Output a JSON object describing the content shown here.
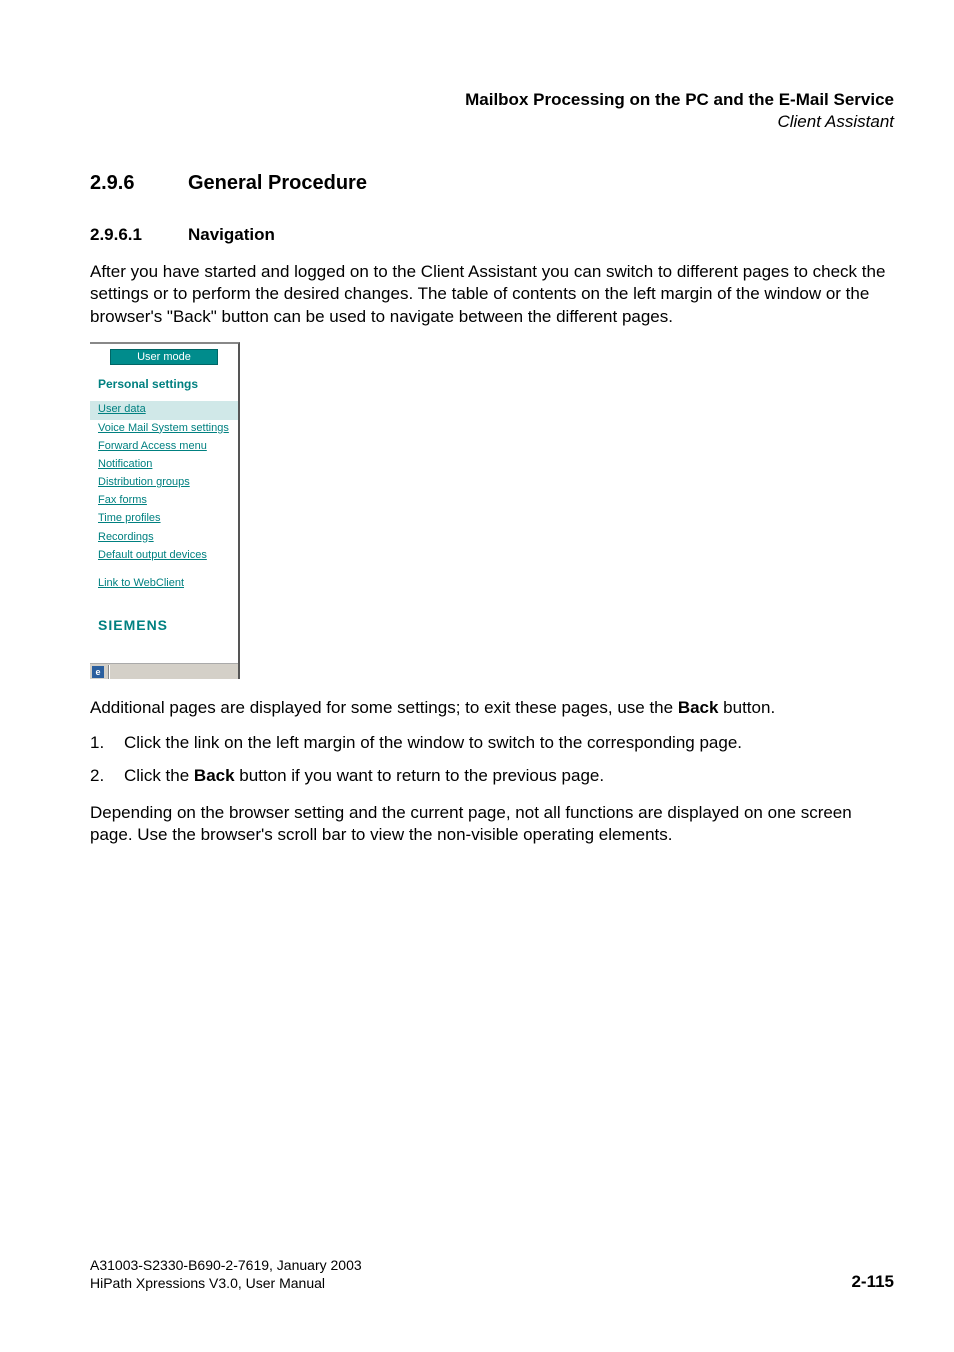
{
  "header": {
    "title": "Mailbox Processing on the PC and the E-Mail Service",
    "subtitle": "Client Assistant"
  },
  "section": {
    "number": "2.9.6",
    "title": "General Procedure"
  },
  "subsection": {
    "number": "2.9.6.1",
    "title": "Navigation"
  },
  "paragraphs": {
    "intro": "After you have started and logged on to the Client Assistant you can switch to different pages to check the settings or to perform the desired changes. The table of contents on the left margin of the window or the browser's \"Back\" button can be used to navigate between the different pages.",
    "after_figure_pre": "Additional pages are displayed for some settings; to exit these pages, use the ",
    "after_figure_bold": "Back",
    "after_figure_post": " button.",
    "closing": "Depending on the browser setting and the current page, not all functions are displayed on one screen page. Use the browser's scroll bar to view the non-visible operating elements."
  },
  "list": {
    "item1_num": "1.",
    "item1_text": "Click the link on the left margin of the window to switch to the corresponding page.",
    "item2_num": "2.",
    "item2_pre": "Click the ",
    "item2_bold": "Back",
    "item2_post": " button if you want to return to the previous page."
  },
  "nav_panel": {
    "mode_button": "User mode",
    "section_title": "Personal settings",
    "links": {
      "user_data": "User data",
      "voice_mail": "Voice Mail System settings",
      "forward": "Forward Access menu",
      "notification": "Notification",
      "distribution": "Distribution groups",
      "fax": "Fax forms",
      "time": "Time profiles",
      "recordings": "Recordings",
      "default_out": "Default output devices",
      "webclient": "Link to WebClient"
    },
    "brand": "SIEMENS",
    "status_icon": "e"
  },
  "footer": {
    "line1": "A31003-S2330-B690-2-7619, January 2003",
    "line2": "HiPath Xpressions V3.0, User Manual",
    "page": "2-115"
  }
}
